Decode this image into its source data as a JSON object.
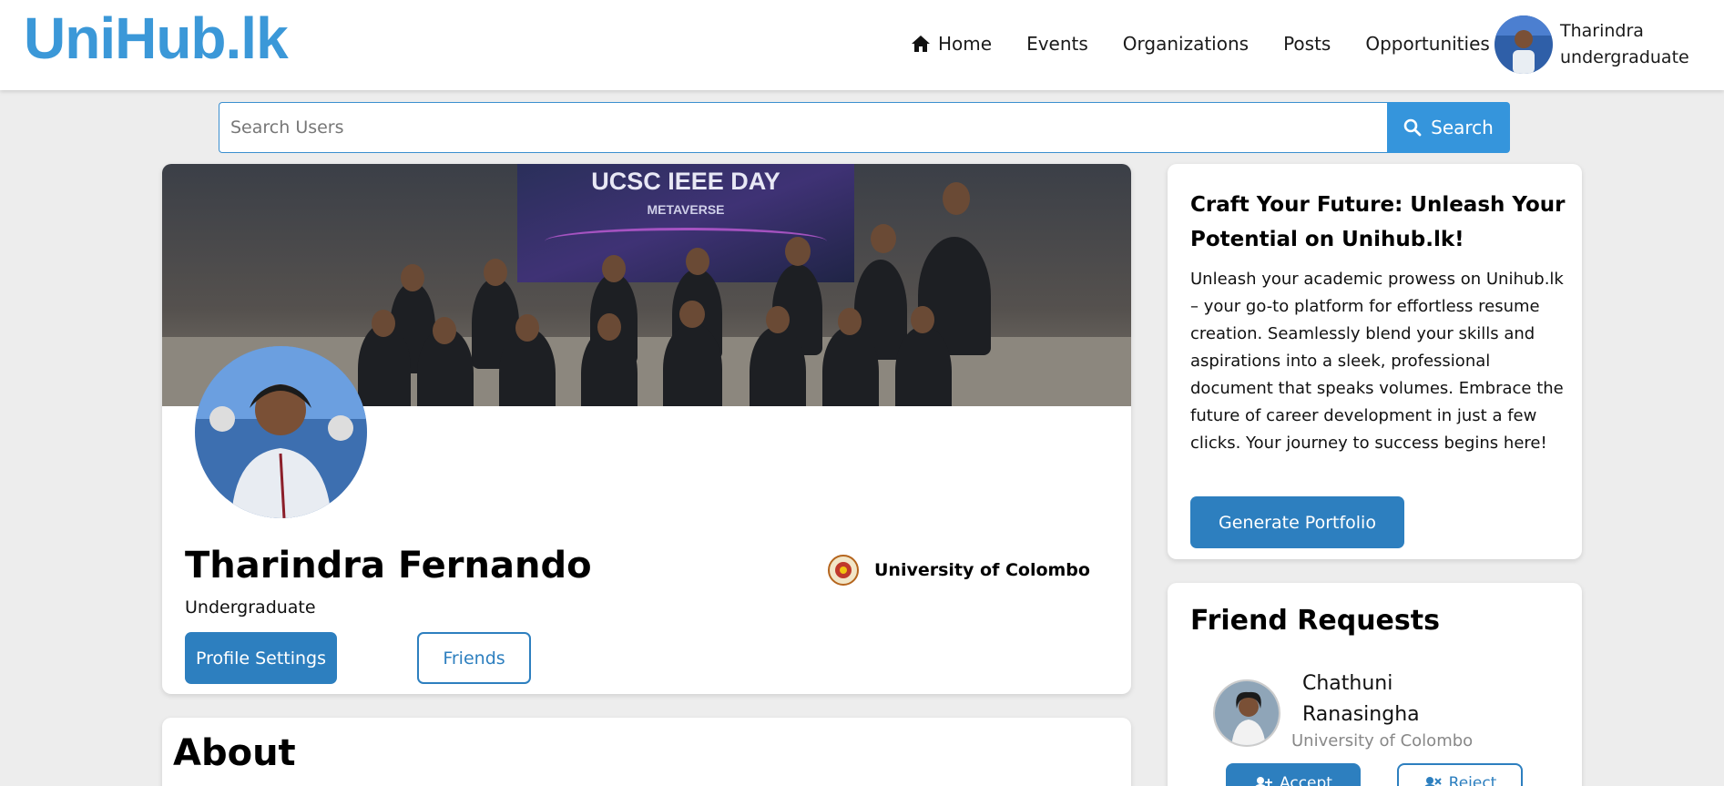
{
  "header": {
    "logo": "UniHub.lk",
    "nav": [
      {
        "label": "Home",
        "icon": "home-icon"
      },
      {
        "label": "Events"
      },
      {
        "label": "Organizations"
      },
      {
        "label": "Posts"
      },
      {
        "label": "Opportunities"
      }
    ],
    "user": {
      "name": "Tharindra",
      "role": "undergraduate"
    }
  },
  "search": {
    "placeholder": "Search Users",
    "button_label": "Search"
  },
  "cover": {
    "banner_title": "UCSC IEEE DAY",
    "banner_subtitle": "METAVERSE"
  },
  "profile": {
    "name": "Tharindra Fernando",
    "role": "Undergraduate",
    "university": "University of Colombo",
    "settings_label": "Profile Settings",
    "friends_label": "Friends"
  },
  "about": {
    "title": "About"
  },
  "promo": {
    "title": "Craft Your Future: Unleash Your Potential on Unihub.lk!",
    "body": "Unleash your academic prowess on Unihub.lk – your go-to platform for effortless resume creation. Seamlessly blend your skills and aspirations into a sleek, professional document that speaks volumes. Embrace the future of career development in just a few clicks. Your journey to success begins here!",
    "button_label": "Generate Portfolio"
  },
  "friend_requests": {
    "title": "Friend Requests",
    "items": [
      {
        "name": "Chathuni Ranasingha",
        "university": "University of Colombo",
        "accept_label": "Accept",
        "reject_label": "Reject"
      }
    ]
  },
  "colors": {
    "brand": "#3b98d8",
    "primary": "#2d7fbf",
    "search": "#3595dc"
  }
}
